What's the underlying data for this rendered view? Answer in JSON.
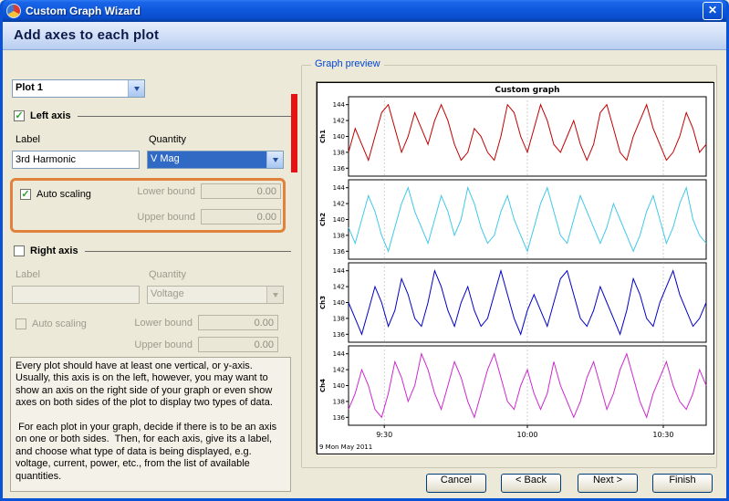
{
  "window": {
    "title": "Custom Graph Wizard"
  },
  "icons": {
    "close": "✕",
    "check": "✓"
  },
  "header": {
    "title": "Add axes to each plot"
  },
  "left_panel": {
    "plot_select": {
      "value": "Plot 1"
    },
    "left_axis": {
      "section_label": "Left axis",
      "label_caption": "Label",
      "quantity_caption": "Quantity",
      "label_value": "3rd Harmonic",
      "quantity_value": "V Mag",
      "auto_scaling_label": "Auto scaling",
      "lower_bound_label": "Lower bound",
      "lower_bound_value": "0.00",
      "upper_bound_label": "Upper bound",
      "upper_bound_value": "0.00"
    },
    "right_axis": {
      "section_label": "Right axis",
      "label_caption": "Label",
      "quantity_caption": "Quantity",
      "label_value": "",
      "quantity_value": "Voltage",
      "auto_scaling_label": "Auto scaling",
      "lower_bound_label": "Lower bound",
      "lower_bound_value": "0.00",
      "upper_bound_label": "Upper bound",
      "upper_bound_value": "0.00"
    },
    "help_text": "Every plot should have at least one vertical, or y-axis.\nUsually, this axis is on the left, however, you may want to\nshow an axis on the right side of your graph or even show\naxes on both sides of the plot to display two types of data.\n\n For each plot in your graph, decide if there is to be an axis\non one or both sides.  Then, for each axis, give its a label,\nand choose what type of data is being displayed, e.g.\nvoltage, current, power, etc., from the list of available\nquantities."
  },
  "preview": {
    "group_label": "Graph preview"
  },
  "footer": {
    "buttons": [
      {
        "label": "Cancel"
      },
      {
        "label": "< Back"
      },
      {
        "label": "Next >"
      },
      {
        "label": "Finish"
      }
    ]
  },
  "chart_data": {
    "type": "line",
    "title": "Custom graph",
    "date_label": "9 Mon May 2011",
    "ylim": [
      135,
      145
    ],
    "y_ticks": [
      136,
      138,
      140,
      142,
      144
    ],
    "x_ticks": [
      {
        "label": "9:30",
        "pos": 0.1
      },
      {
        "label": "10:00",
        "pos": 0.5
      },
      {
        "label": "10:30",
        "pos": 0.88
      }
    ],
    "grid": true,
    "legend": "per-subplot-ylabel",
    "series": [
      {
        "name": "Ch1",
        "color": "#c00000",
        "values": [
          138,
          141,
          139,
          137,
          140,
          143,
          144,
          141,
          138,
          140,
          143,
          141,
          139,
          142,
          144,
          142,
          139,
          137,
          138,
          141,
          140,
          138,
          137,
          140,
          144,
          143,
          140,
          138,
          141,
          144,
          142,
          139,
          138,
          140,
          142,
          139,
          137,
          139,
          143,
          144,
          141,
          138,
          137,
          140,
          142,
          144,
          141,
          139,
          137,
          138,
          140,
          143,
          141,
          138,
          139
        ]
      },
      {
        "name": "Ch2",
        "color": "#40c8e8",
        "values": [
          139,
          137,
          140,
          143,
          141,
          138,
          136,
          139,
          142,
          144,
          141,
          139,
          137,
          140,
          143,
          141,
          138,
          140,
          144,
          142,
          139,
          137,
          138,
          141,
          143,
          140,
          138,
          136,
          139,
          142,
          144,
          141,
          138,
          137,
          140,
          143,
          141,
          139,
          137,
          139,
          142,
          140,
          138,
          136,
          138,
          141,
          143,
          140,
          137,
          139,
          142,
          144,
          140,
          138,
          137
        ]
      },
      {
        "name": "Ch3",
        "color": "#0000c8",
        "values": [
          140,
          138,
          136,
          139,
          142,
          140,
          137,
          139,
          143,
          141,
          138,
          137,
          140,
          144,
          142,
          139,
          137,
          140,
          142,
          139,
          137,
          138,
          141,
          144,
          141,
          138,
          136,
          139,
          141,
          139,
          137,
          140,
          143,
          144,
          141,
          138,
          137,
          139,
          142,
          140,
          138,
          136,
          139,
          143,
          141,
          138,
          137,
          140,
          142,
          144,
          141,
          139,
          137,
          138,
          140
        ]
      },
      {
        "name": "Ch4",
        "color": "#cc29cc",
        "values": [
          137,
          139,
          142,
          140,
          137,
          136,
          139,
          143,
          141,
          138,
          140,
          144,
          142,
          139,
          137,
          140,
          143,
          141,
          138,
          136,
          139,
          142,
          144,
          141,
          138,
          137,
          140,
          142,
          139,
          137,
          139,
          143,
          140,
          138,
          136,
          138,
          141,
          143,
          140,
          137,
          139,
          142,
          144,
          141,
          138,
          136,
          139,
          141,
          143,
          140,
          138,
          137,
          139,
          142,
          140
        ]
      }
    ]
  }
}
